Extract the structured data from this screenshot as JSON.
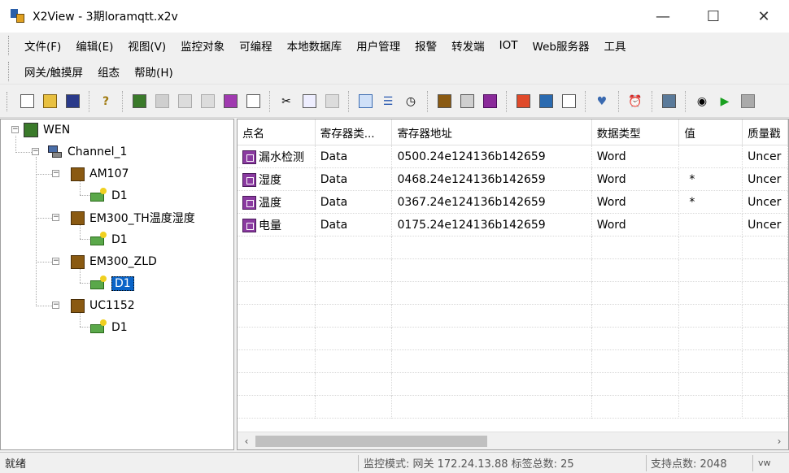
{
  "window": {
    "title": "X2View - 3期loramqtt.x2v",
    "minimize_glyph": "—",
    "maximize_glyph": "☐",
    "close_glyph": "✕"
  },
  "menu": {
    "row1": [
      "文件(F)",
      "编辑(E)",
      "视图(V)",
      "监控对象",
      "可编程",
      "本地数据库",
      "用户管理",
      "报警",
      "转发端",
      "IOT",
      "Web服务器",
      "工具"
    ],
    "row2": [
      "网关/触摸屏",
      "组态",
      "帮助(H)"
    ]
  },
  "toolbar": {
    "icons": [
      "new-file-icon",
      "open-folder-icon",
      "save-icon",
      "help-icon",
      "gateway-icon",
      "arrow-icon",
      "doc-icon",
      "edit-icon",
      "cube-icon",
      "export-icon",
      "cut-icon",
      "copy-icon",
      "paste-icon",
      "tree-icon",
      "list-icon",
      "clock-icon",
      "tools-icon",
      "device-icon",
      "b-icon",
      "chart-icon",
      "monitor-icon",
      "page-icon",
      "shield-icon",
      "alarm-icon",
      "server-icon",
      "eye-icon",
      "play-icon",
      "stop-icon"
    ]
  },
  "tree": {
    "root": "WEN",
    "channel": "Channel_1",
    "devices": [
      {
        "name": "AM107",
        "child": "D1"
      },
      {
        "name": "EM300_TH温度湿度",
        "child": "D1"
      },
      {
        "name": "EM300_ZLD",
        "child": "D1"
      },
      {
        "name": "UC1152",
        "child": "D1"
      }
    ],
    "expander_minus": "−"
  },
  "table": {
    "columns": [
      "点名",
      "寄存器类...",
      "寄存器地址",
      "数据类型",
      "值",
      "质量戳"
    ],
    "rows": [
      {
        "name": "漏水检测",
        "reg_type": "Data",
        "address": "0500.24e124136b142659",
        "data_type": "Word",
        "value": "",
        "quality": "Uncer"
      },
      {
        "name": "湿度",
        "reg_type": "Data",
        "address": "0468.24e124136b142659",
        "data_type": "Word",
        "value": "*",
        "quality": "Uncer"
      },
      {
        "name": "温度",
        "reg_type": "Data",
        "address": "0367.24e124136b142659",
        "data_type": "Word",
        "value": "*",
        "quality": "Uncer"
      },
      {
        "name": "电量",
        "reg_type": "Data",
        "address": "0175.24e124136b142659",
        "data_type": "Word",
        "value": "",
        "quality": "Uncer"
      }
    ],
    "scroll_left": "‹",
    "scroll_right": "›"
  },
  "status": {
    "ready": "就绪",
    "mode": "监控模式: 网关 172.24.13.88 标签总数: 25",
    "count": "支持点数: 2048",
    "extra": "vw"
  },
  "colors": {
    "selection": "#0a64c8",
    "tag_icon": "#8a3aa0",
    "device_icon": "#8a5a12"
  }
}
